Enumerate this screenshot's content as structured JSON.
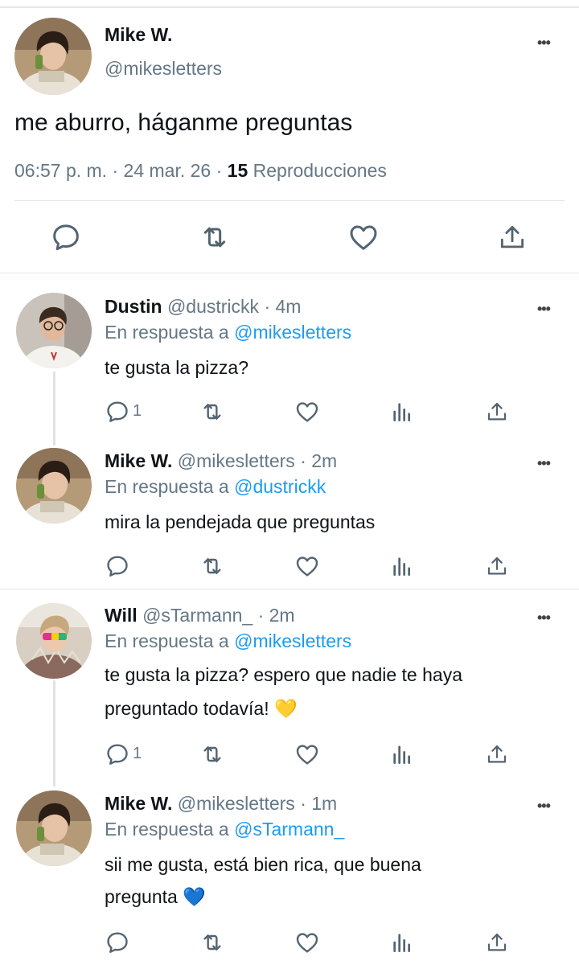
{
  "colors": {
    "accent": "#1d9bf0",
    "secondary_text": "#657786",
    "divider": "#e3e6e8"
  },
  "main_tweet": {
    "display_name": "Mike W.",
    "handle": "@mikesletters",
    "text": "me aburro, háganme preguntas",
    "time": "06:57 p. m.",
    "date": "24 mar. 26",
    "view_count": "15",
    "view_label": "Reproducciones",
    "dot": "·"
  },
  "replies": [
    {
      "display_name": "Dustin",
      "handle": "@dustrickk",
      "age": "· 4m",
      "reply_prefix": "En respuesta a",
      "reply_to": "@mikesletters",
      "text_line1": "te gusta la pizza?",
      "text_line2": "",
      "reply_count": "1"
    },
    {
      "display_name": "Mike W.",
      "handle": "@mikesletters",
      "age": "· 2m",
      "reply_prefix": "En respuesta a",
      "reply_to": "@dustrickk",
      "text_line1": "mira la pendejada que preguntas",
      "text_line2": "",
      "reply_count": ""
    },
    {
      "display_name": "Will",
      "handle": "@sTarmann_",
      "age": "· 2m",
      "reply_prefix": "En respuesta a",
      "reply_to": "@mikesletters",
      "text_line1": "te gusta la pizza? espero que nadie te haya",
      "text_line2": "preguntado todavía! 💛",
      "reply_count": "1"
    },
    {
      "display_name": "Mike W.",
      "handle": "@mikesletters",
      "age": "· 1m",
      "reply_prefix": "En respuesta a",
      "reply_to": "@sTarmann_",
      "text_line1": "sii me gusta, está bien rica, que buena",
      "text_line2": "pregunta 💙",
      "reply_count": ""
    }
  ],
  "icons": {
    "more": "more-icon",
    "reply": "reply-icon",
    "retweet": "retweet-icon",
    "like": "heart-icon",
    "views": "views-icon",
    "share": "share-icon"
  }
}
